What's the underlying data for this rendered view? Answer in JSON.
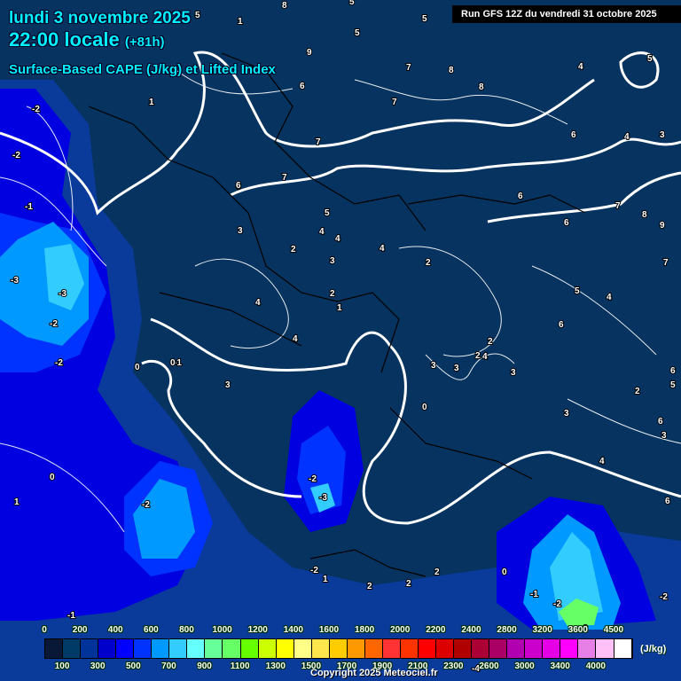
{
  "header": {
    "date": "lundi 3 novembre 2025",
    "time": "22:00 locale",
    "lead": "(+81h)",
    "product": "Surface-Based CAPE (J/kg) et Lifted Index",
    "run": "Run GFS 12Z du vendredi 31 octobre 2025"
  },
  "legend": {
    "unit": "(J/kg)",
    "colors": [
      "#0a1838",
      "#003a66",
      "#003399",
      "#0000cc",
      "#0000ff",
      "#0033ff",
      "#0099ff",
      "#33ccff",
      "#66ffff",
      "#66ff99",
      "#66ff66",
      "#66ff00",
      "#ccff00",
      "#ffff00",
      "#ffff88",
      "#ffe64d",
      "#ffcc00",
      "#ff9900",
      "#ff6600",
      "#ff3333",
      "#ff3300",
      "#ff0000",
      "#dd0000",
      "#b00000",
      "#aa0033",
      "#aa0066",
      "#b000b0",
      "#cc00cc",
      "#e600e6",
      "#ff00ff",
      "#e680e6",
      "#ffc0f8",
      "#ffffff"
    ],
    "top_labels": [
      "0",
      "200",
      "400",
      "600",
      "800",
      "1000",
      "1200",
      "1400",
      "1600",
      "1800",
      "2000",
      "2200",
      "2400",
      "2800",
      "3200",
      "3600",
      "4500"
    ],
    "bottom_labels": [
      "100",
      "300",
      "500",
      "700",
      "900",
      "1100",
      "1300",
      "1500",
      "1700",
      "1900",
      "2100",
      "2300",
      "2600",
      "3000",
      "3400",
      "4000"
    ]
  },
  "lifted_index_labels": [
    "-2",
    "-2",
    "-1",
    "-3",
    "-3",
    "-2",
    "-2",
    "0",
    "0",
    "-1",
    "0",
    "1",
    "-2",
    "-2",
    "-3",
    "-1",
    "-2",
    "1",
    "2",
    "2",
    "2",
    "0",
    "-1",
    "-2",
    "-3",
    "-4",
    "-2",
    "1",
    "8",
    "5",
    "7",
    "5",
    "9",
    "6",
    "5",
    "7",
    "7",
    "8",
    "8",
    "4",
    "5",
    "6",
    "7",
    "6",
    "4",
    "3",
    "6",
    "5",
    "4",
    "4",
    "4",
    "6",
    "7",
    "8",
    "9",
    "6",
    "7",
    "3",
    "4",
    "2",
    "3",
    "2",
    "4",
    "2",
    "1",
    "2",
    "3",
    "2",
    "3",
    "4",
    "3",
    "5",
    "6",
    "2",
    "3",
    "0",
    "6",
    "5",
    "6",
    "3",
    "4",
    "6",
    "3",
    "1",
    "5",
    "4"
  ],
  "copyright": "Copyright 2025 Meteociel.fr"
}
